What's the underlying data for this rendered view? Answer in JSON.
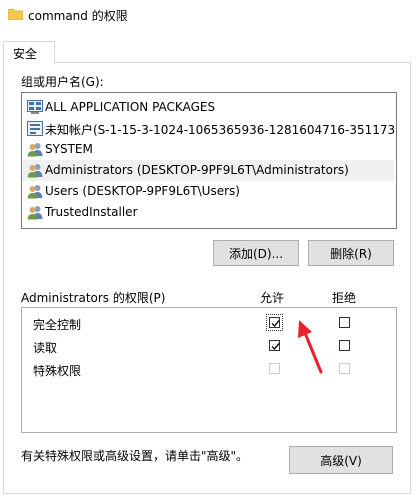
{
  "window": {
    "title": "command 的权限"
  },
  "tabs": [
    {
      "label": "安全"
    }
  ],
  "groups": {
    "label": "组或用户名(G):",
    "items": [
      {
        "icon": "app-packages-icon",
        "label": "ALL APPLICATION PACKAGES"
      },
      {
        "icon": "unknown-account-icon",
        "label": "未知帐户(S-1-15-3-1024-1065365936-1281604716-351173..."
      },
      {
        "icon": "user-group-icon",
        "label": "SYSTEM"
      },
      {
        "icon": "user-group-icon",
        "label": "Administrators (DESKTOP-9PF9L6T\\Administrators)"
      },
      {
        "icon": "user-group-icon",
        "label": "Users (DESKTOP-9PF9L6T\\Users)"
      },
      {
        "icon": "user-group-icon",
        "label": "TrustedInstaller"
      }
    ],
    "add_label": "添加(D)...",
    "remove_label": "删除(R)"
  },
  "permissions": {
    "header": "Administrators 的权限(P)",
    "allow_label": "允许",
    "deny_label": "拒绝",
    "rows": [
      {
        "label": "完全控制",
        "allow": true,
        "deny": false,
        "enabled": true
      },
      {
        "label": "读取",
        "allow": true,
        "deny": false,
        "enabled": true
      },
      {
        "label": "特殊权限",
        "allow": false,
        "deny": false,
        "enabled": false
      }
    ]
  },
  "footer": {
    "hint": "有关特殊权限或高级设置，请单击\"高级\"。",
    "advanced_label": "高级(V)"
  },
  "colors": {
    "selected_row": "#f0f0f0",
    "arrow": "#e8212c",
    "folder": "#f5c84c"
  }
}
